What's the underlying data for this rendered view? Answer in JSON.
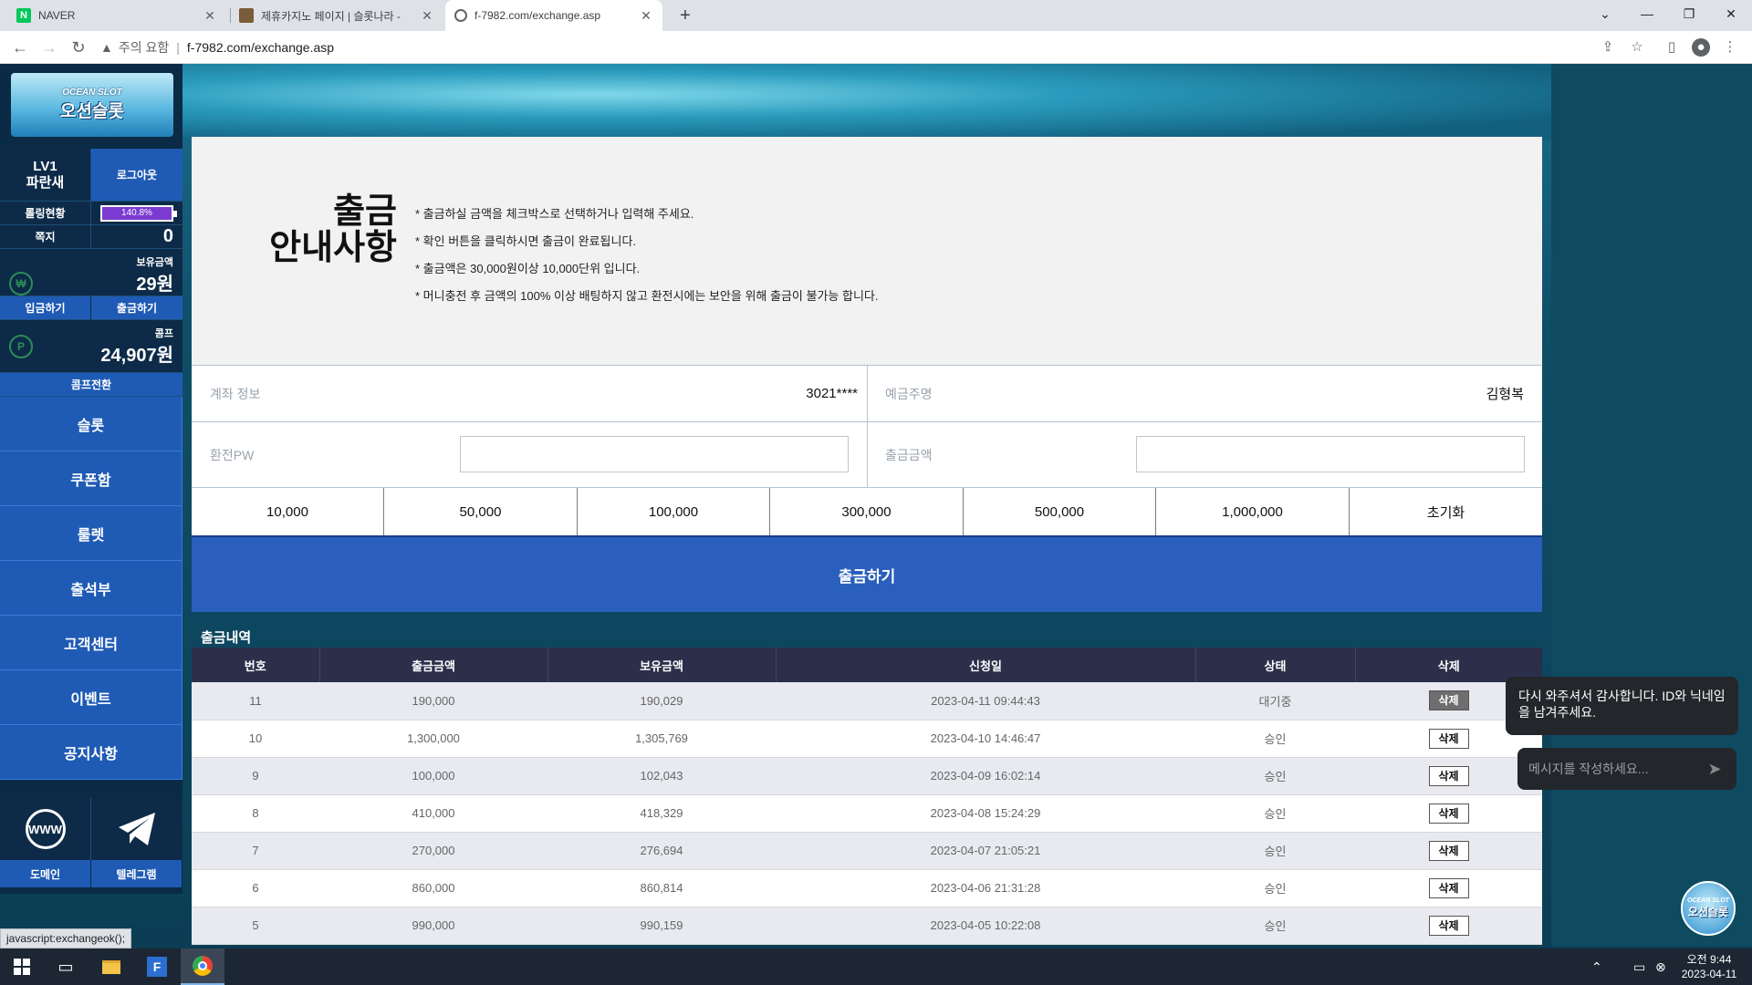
{
  "browser": {
    "tabs": [
      {
        "title": "NAVER",
        "favicon": "N"
      },
      {
        "title": "제휴카지노 페이지 | 슬롯나라 -",
        "favicon": ""
      },
      {
        "title": "f-7982.com/exchange.asp",
        "favicon": ""
      }
    ],
    "new_tab": "+",
    "security_label": "주의 요함",
    "url": "f-7982.com/exchange.asp"
  },
  "sidebar": {
    "logo_en": "OCEAN SLOT",
    "logo_ko": "오션슬롯",
    "level": "LV1",
    "nickname": "파란새",
    "logout": "로그아웃",
    "rolling_label": "롤링현황",
    "rolling_value": "140.8%",
    "rolling_fill": 1.0,
    "note_label": "쪽지",
    "note_count": "0",
    "money_label": "보유금액",
    "money_value": "29원",
    "deposit": "입금하기",
    "withdraw": "출금하기",
    "comp_label": "콤프",
    "comp_value": "24,907원",
    "comp_convert": "콤프전환",
    "menu": [
      "슬롯",
      "쿠폰함",
      "룰렛",
      "출석부",
      "고객센터",
      "이벤트",
      "공지사항"
    ],
    "domain_icon_text": "WWW",
    "domain_label": "도메인",
    "telegram_label": "텔레그램"
  },
  "notice": {
    "title_line1": "출금",
    "title_line2": "안내사항",
    "items": [
      "* 출금하실 금액을 체크박스로 선택하거나 입력해 주세요.",
      "* 확인 버튼을 클릭하시면 출금이 완료됩니다.",
      "* 출금액은 30,000원이상 10,000단위 입니다.",
      "* 머니충전 후 금액의 100% 이상 배팅하지 않고 환전시에는 보안을 위해 출금이 불가능 합니다."
    ]
  },
  "form": {
    "account_label": "계좌 정보",
    "account_value": "3021****",
    "holder_label": "예금주명",
    "holder_value": "김형복",
    "pw_label": "환전PW",
    "pw_value": "",
    "amount_label": "출금금액",
    "amount_value": ""
  },
  "amount_buttons": [
    "10,000",
    "50,000",
    "100,000",
    "300,000",
    "500,000",
    "1,000,000",
    "초기화"
  ],
  "submit_label": "출금하기",
  "history": {
    "title": "출금내역",
    "columns": [
      "번호",
      "출금금액",
      "보유금액",
      "신청일",
      "상태",
      "삭제"
    ],
    "rows": [
      {
        "no": "11",
        "amount": "190,000",
        "balance": "190,029",
        "date": "2023-04-11 09:44:43",
        "status": "대기중",
        "del": "삭제"
      },
      {
        "no": "10",
        "amount": "1,300,000",
        "balance": "1,305,769",
        "date": "2023-04-10 14:46:47",
        "status": "승인",
        "del": "삭제"
      },
      {
        "no": "9",
        "amount": "100,000",
        "balance": "102,043",
        "date": "2023-04-09 16:02:14",
        "status": "승인",
        "del": "삭제"
      },
      {
        "no": "8",
        "amount": "410,000",
        "balance": "418,329",
        "date": "2023-04-08 15:24:29",
        "status": "승인",
        "del": "삭제"
      },
      {
        "no": "7",
        "amount": "270,000",
        "balance": "276,694",
        "date": "2023-04-07 21:05:21",
        "status": "승인",
        "del": "삭제"
      },
      {
        "no": "6",
        "amount": "860,000",
        "balance": "860,814",
        "date": "2023-04-06 21:31:28",
        "status": "승인",
        "del": "삭제"
      },
      {
        "no": "5",
        "amount": "990,000",
        "balance": "990,159",
        "date": "2023-04-05 10:22:08",
        "status": "승인",
        "del": "삭제"
      }
    ]
  },
  "chat": {
    "message": "다시 와주셔서 감사합니다. ID와 닉네임을 남겨주세요.",
    "placeholder": "메시지를 작성하세요...",
    "logo_en": "OCEAN SLOT",
    "logo_ko": "오션슬롯"
  },
  "status_bar_url": "javascript:exchangeok();",
  "taskbar": {
    "time": "오전 9:44",
    "date": "2023-04-11"
  },
  "colors": {
    "accent_blue": "#2a5fbd",
    "table_header": "#2b2f4a",
    "sidebar_dark": "#0b2a45"
  }
}
